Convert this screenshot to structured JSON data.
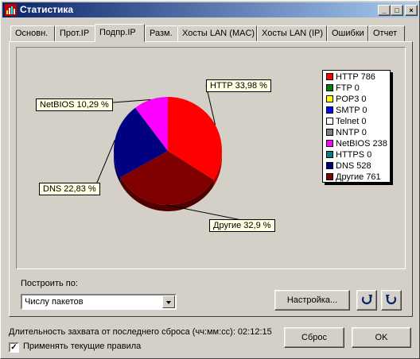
{
  "window": {
    "title": "Статистика",
    "controls": {
      "minimize": "_",
      "maximize": "□",
      "close": "×"
    }
  },
  "tabs": [
    {
      "label": "Основн."
    },
    {
      "label": "Прот.IP"
    },
    {
      "label": "Подпр.IP",
      "active": true
    },
    {
      "label": "Разм."
    },
    {
      "label": "Хосты LAN (MAC)"
    },
    {
      "label": "Хосты LAN (IP)"
    },
    {
      "label": "Ошибки"
    },
    {
      "label": "Отчет"
    }
  ],
  "chart_data": {
    "type": "pie",
    "slices": [
      {
        "name": "HTTP",
        "value": 786,
        "percent_label": "HTTP 33,98 %",
        "color": "#ff0000",
        "dark": "#b00000"
      },
      {
        "name": "Другие",
        "value": 761,
        "percent_label": "Другие 32,9 %",
        "color": "#800000",
        "dark": "#500000"
      },
      {
        "name": "DNS",
        "value": 528,
        "percent_label": "DNS 22,83 %",
        "color": "#000080",
        "dark": "#000050"
      },
      {
        "name": "NetBIOS",
        "value": 238,
        "percent_label": "NetBIOS 10,29 %",
        "color": "#ff00ff",
        "dark": "#b000b0"
      }
    ],
    "legend": [
      {
        "label": "HTTP 786",
        "color": "#ff0000"
      },
      {
        "label": "FTP 0",
        "color": "#008000"
      },
      {
        "label": "POP3 0",
        "color": "#ffff00"
      },
      {
        "label": "SMTP 0",
        "color": "#0000ff"
      },
      {
        "label": "Telnet 0",
        "color": "#ffffff"
      },
      {
        "label": "NNTP 0",
        "color": "#808080"
      },
      {
        "label": "NetBIOS 238",
        "color": "#ff00ff"
      },
      {
        "label": "HTTPS 0",
        "color": "#008080"
      },
      {
        "label": "DNS 528",
        "color": "#000080"
      },
      {
        "label": "Другие 761",
        "color": "#800000"
      }
    ],
    "legend_placement": "right"
  },
  "build_by": {
    "label": "Построить по:",
    "value": "Числу пакетов"
  },
  "buttons": {
    "settings": "Настройка...",
    "reset": "Сброс",
    "ok": "OK"
  },
  "status": {
    "duration_text": "Длительность захвата от последнего сброса (чч:мм:сс): 02:12:15"
  },
  "apply_rules": {
    "label": "Применять текущие правила",
    "checked": true,
    "mark": "✓"
  },
  "colors": {
    "title_start": "#0a246a",
    "title_end": "#a6caf0",
    "face": "#d4d0c8",
    "callout_bg": "#ffffe1",
    "refresh_icon": "#0a246a"
  }
}
